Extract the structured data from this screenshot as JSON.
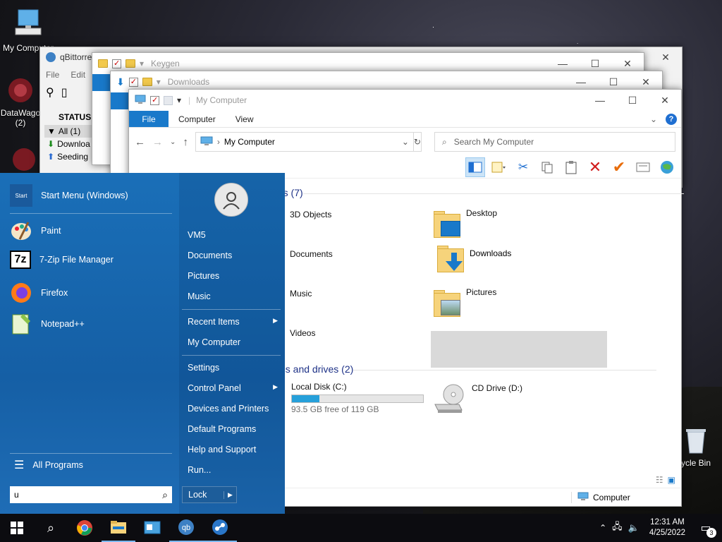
{
  "desktop": {
    "icons": [
      {
        "label": "My Computer"
      },
      {
        "label": "DataWago (2)"
      },
      {
        "label": "ycle Bin"
      }
    ]
  },
  "windows": {
    "qbittorrent": {
      "title": "qBittorre",
      "menu": [
        "File",
        "Edit"
      ],
      "status_header": "STATUS",
      "filters": [
        "All (1)",
        "Downloa",
        "Seeding"
      ]
    },
    "keygen": {
      "title": "Keygen"
    },
    "downloads": {
      "title": "Downloads"
    },
    "explorer": {
      "title": "My Computer",
      "tabs": {
        "file": "File",
        "computer": "Computer",
        "view": "View"
      },
      "help": "?",
      "address": "My Computer",
      "search_placeholder": "Search My Computer",
      "groups": {
        "folders": "rs (7)",
        "drives": "es and drives (2)"
      },
      "folders": [
        {
          "label": "3D Objects"
        },
        {
          "label": "Desktop"
        },
        {
          "label": "Documents"
        },
        {
          "label": "Downloads",
          "selected": true
        },
        {
          "label": "Music"
        },
        {
          "label": "Pictures"
        },
        {
          "label": "Videos"
        }
      ],
      "drives": [
        {
          "label": "Local Disk (C:)",
          "free_text": "93.5 GB free of 119 GB",
          "used_fraction": 0.21
        },
        {
          "label": "CD Drive (D:)"
        }
      ],
      "status_right": "Computer"
    }
  },
  "start_menu": {
    "pinned": [
      {
        "label": "Start Menu (Windows)"
      },
      {
        "label": "Paint"
      },
      {
        "label": "7-Zip File Manager"
      },
      {
        "label": "Firefox"
      },
      {
        "label": "Notepad++"
      }
    ],
    "all_programs": "All Programs",
    "search_value": "u",
    "right": {
      "user": "VM5",
      "items_1": [
        "Documents",
        "Pictures",
        "Music"
      ],
      "recent_items": "Recent Items",
      "my_computer": "My Computer",
      "settings": "Settings",
      "control_panel": "Control Panel",
      "devices": "Devices and Printers",
      "default_programs": "Default Programs",
      "help": "Help and Support",
      "run": "Run...",
      "lock": "Lock"
    }
  },
  "taskbar": {
    "time": "12:31 AM",
    "date": "4/25/2022",
    "notifications": "3"
  },
  "colors": {
    "accent": "#1979ca",
    "start_menu": "#155fa5",
    "disk_fill": "#26a0da"
  }
}
